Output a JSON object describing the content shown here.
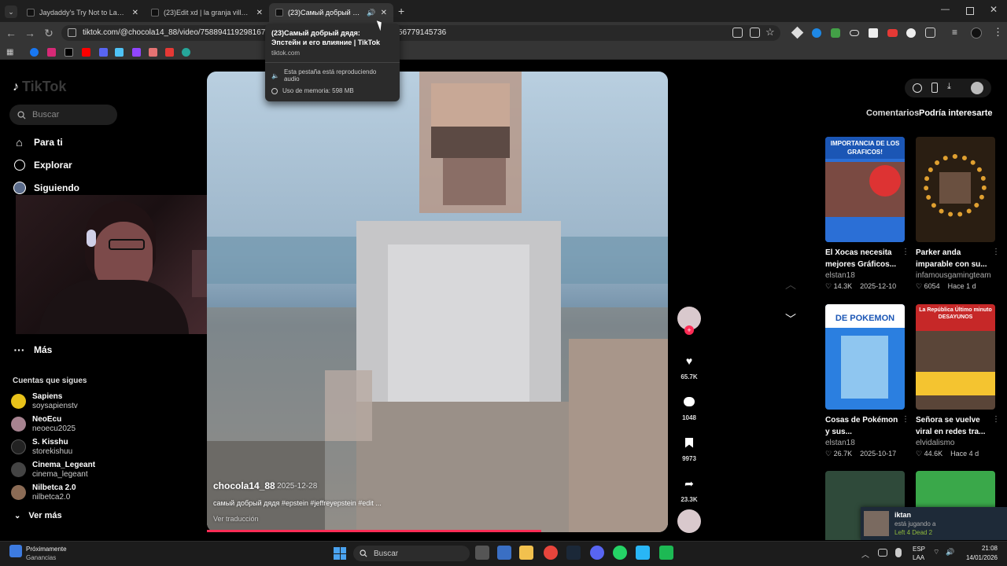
{
  "browser": {
    "tabs": [
      {
        "title": "Jaydaddy's Try Not to Laugh Ch",
        "close": "✕"
      },
      {
        "title": "(23)Edit xd | la granja villa | TikT",
        "close": "✕"
      },
      {
        "title": "(23)Самый добрый дядя: Эпсте",
        "close": "✕"
      }
    ],
    "new_tab": "+",
    "url": "tiktok.com/@chocola14_88/video/758894119298167937",
    "url_tail": "56779145736"
  },
  "tooltip": {
    "title": "(23)Самый добрый дядя: Эпстейн и его влияние | TikTok",
    "domain": "tiktok.com",
    "audio": "Esta pestaña está reproduciendo audio",
    "memory": "Uso de memoria: 598 MB"
  },
  "sidebar": {
    "logo": "TikTok",
    "search_placeholder": "Buscar",
    "nav": [
      {
        "label": "Para ti"
      },
      {
        "label": "Explorar"
      },
      {
        "label": "Siguiendo"
      },
      {
        "label": "Más"
      }
    ],
    "following_heading": "Cuentas que sigues",
    "accounts": [
      {
        "name": "Sapiens",
        "handle": "soysapienstv",
        "color": "#e8c21a"
      },
      {
        "name": "NeoEcu",
        "handle": "neoecu2025",
        "color": "#a78390"
      },
      {
        "name": "S. Kisshu",
        "handle": "storekishuu",
        "color": "#222"
      },
      {
        "name": "Cinema_Legeant",
        "handle": "cinema_legeant",
        "color": "#444"
      },
      {
        "name": "Nilbetca 2.0",
        "handle": "nilbetca2.0",
        "color": "#8b6b55"
      }
    ],
    "see_more": "Ver más"
  },
  "video": {
    "author": "chocola14_88",
    "date": "· 2025-12-28",
    "caption": "самый добрый дядя #epstein #jeffreyepstein #edit ...",
    "translate": "Ver traducción",
    "progress": 0.725
  },
  "actions": {
    "likes": "65.7K",
    "comments": "1048",
    "saves": "9973",
    "shares": "23.3K"
  },
  "right_panel": {
    "tab_comments": "Comentarios",
    "tab_interest": "Podría interesarte",
    "cards": [
      {
        "title": "El Xocas necesita mejores Gráficos...",
        "author": "elstan18",
        "likes": "14.3K",
        "date": "2025-12-10",
        "thumb_text": "IMPORTANCIA DE LOS GRAFICOS!"
      },
      {
        "title": "Parker anda imparable con su...",
        "author": "infamousgamingteam",
        "likes": "6054",
        "date": "Hace 1 d",
        "thumb_text": ""
      },
      {
        "title": "Cosas de Pokémon y sus...",
        "author": "elstan18",
        "likes": "26.7K",
        "date": "2025-10-17",
        "thumb_text": "DE POKEMON"
      },
      {
        "title": "Señora se vuelve viral en redes tra...",
        "author": "elvidalismo",
        "likes": "44.6K",
        "date": "Hace 4 d",
        "thumb_text": "La República Último minuto DESAYUNOS"
      }
    ],
    "notification": {
      "name": "iktan",
      "status": "está jugando a",
      "game": "Left 4 Dead 2"
    }
  },
  "taskbar": {
    "weather_title": "Próximamente",
    "weather_sub": "Ganancias",
    "search": "Buscar",
    "lang1": "ESP",
    "lang2": "LAA",
    "time": "21:08",
    "date": "14/01/2026"
  }
}
